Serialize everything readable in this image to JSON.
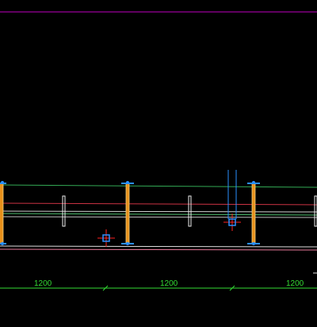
{
  "drawing": {
    "background": "#000000",
    "colors": {
      "frame_line": "#c000c0",
      "beam_line": "#33aa55",
      "red_line": "#cc3344",
      "white_line": "#dddddd",
      "pink_line": "#e87a9a",
      "column_fill": "#e8901a",
      "column_edge": "#f0d080",
      "base_plate": "#2a8fff",
      "marker": "#ff2222",
      "marker_box": "#2a8fff",
      "dimension": "#33dd33"
    },
    "dimensions": {
      "labels": [
        "1200",
        "1200",
        "1200"
      ]
    },
    "icons": [
      "column-icon",
      "crosshair-marker-icon",
      "opening-slot-icon"
    ]
  }
}
